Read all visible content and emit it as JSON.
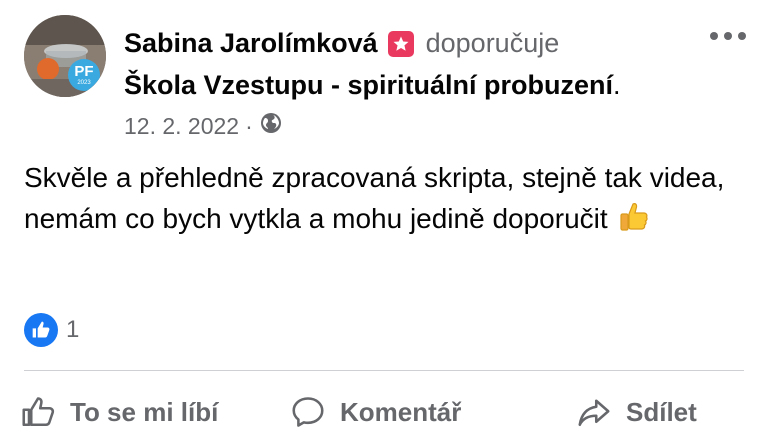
{
  "post": {
    "author": "Sabina Jarolímková",
    "recommend_verb": "doporučuje",
    "page_name": "Škola Vzestupu - spirituální probuzení",
    "page_suffix": ".",
    "date": "12. 2. 2022",
    "separator": "·",
    "privacy_icon": "globe-icon",
    "avatar_badge": {
      "text": "PF",
      "year": "2023"
    },
    "body": "Skvěle a přehledně zpracovaná skripta, stejně tak videa, nemám co bych vytkla a mohu jedině doporučit",
    "body_emoji": "thumbs-up",
    "reactions": {
      "icon": "like-icon",
      "count": "1"
    }
  },
  "actions": {
    "like": "To se mi líbí",
    "comment": "Komentář",
    "share": "Sdílet"
  },
  "colors": {
    "accent": "#1877f2",
    "recommend_badge": "#e9395e",
    "secondary_text": "#65676b",
    "divider": "#ced0d4"
  }
}
